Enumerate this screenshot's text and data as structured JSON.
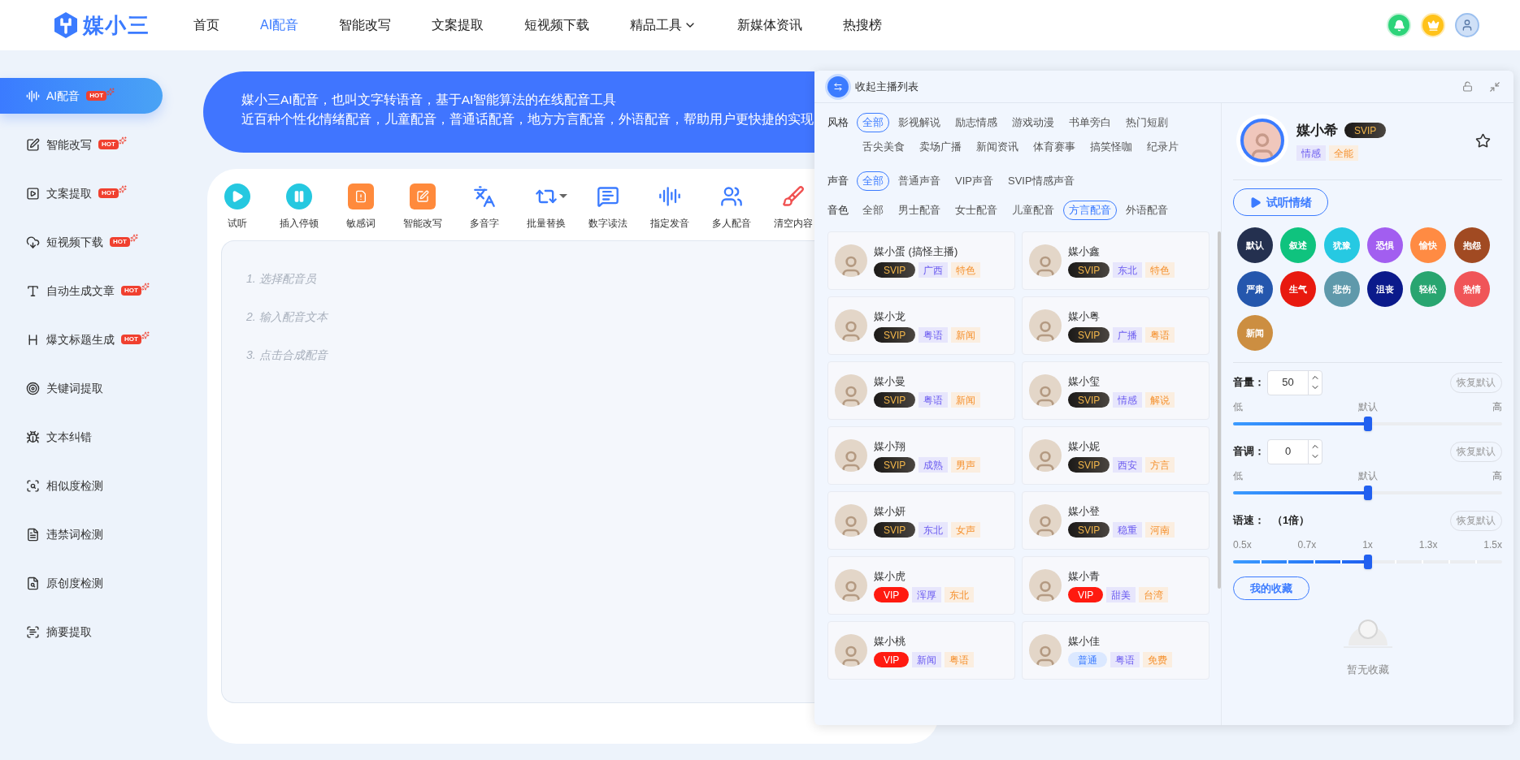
{
  "header": {
    "logo": "媒小三",
    "nav": [
      {
        "label": "首页",
        "selected": false,
        "has_menu": false
      },
      {
        "label": "AI配音",
        "selected": true,
        "has_menu": false
      },
      {
        "label": "智能改写",
        "selected": false,
        "has_menu": false
      },
      {
        "label": "文案提取",
        "selected": false,
        "has_menu": false
      },
      {
        "label": "短视频下载",
        "selected": false,
        "has_menu": false
      },
      {
        "label": "精品工具",
        "selected": false,
        "has_menu": true
      },
      {
        "label": "新媒体资讯",
        "selected": false,
        "has_menu": false
      },
      {
        "label": "热搜榜",
        "selected": false,
        "has_menu": false
      }
    ]
  },
  "sidebar": {
    "items": [
      {
        "label": "AI配音",
        "selected": true,
        "badge": "HOT"
      },
      {
        "label": "智能改写",
        "selected": false,
        "badge": "HOT"
      },
      {
        "label": "文案提取",
        "selected": false,
        "badge": "HOT"
      },
      {
        "label": "短视频下载",
        "selected": false,
        "badge": "HOT"
      },
      {
        "label": "自动生成文章",
        "selected": false,
        "badge": "HOT"
      },
      {
        "label": "爆文标题生成",
        "selected": false,
        "badge": "HOT"
      },
      {
        "label": "关键词提取",
        "selected": false
      },
      {
        "label": "文本纠错",
        "selected": false
      },
      {
        "label": "相似度检测",
        "selected": false
      },
      {
        "label": "违禁词检测",
        "selected": false
      },
      {
        "label": "原创度检测",
        "selected": false
      },
      {
        "label": "摘要提取",
        "selected": false
      }
    ]
  },
  "banner": {
    "lines": [
      "媒小三AI配音，也叫文字转语音，基于AI智能算法的在线配音工具",
      "近百种个性化情绪配音，儿童配音，普通话配音，地方方言配音，外语配音，帮助用户更快捷的实现"
    ]
  },
  "toolbar": [
    {
      "label": "试听",
      "has_menu": false
    },
    {
      "label": "插入停顿",
      "has_menu": false
    },
    {
      "label": "敏感词",
      "has_menu": false
    },
    {
      "label": "智能改写",
      "has_menu": false
    },
    {
      "label": "多音字",
      "has_menu": false
    },
    {
      "label": "批量替换",
      "has_menu": true
    },
    {
      "label": "数字读法",
      "has_menu": false
    },
    {
      "label": "指定发音",
      "has_menu": false
    },
    {
      "label": "多人配音",
      "has_menu": false
    },
    {
      "label": "清空内容",
      "has_menu": false
    }
  ],
  "editor": {
    "steps": [
      "1. 选择配音员",
      "2. 输入配音文本",
      "3. 点击合成配音"
    ]
  },
  "panel": {
    "collapse_label": "收起主播列表",
    "filters": [
      {
        "label": "风格",
        "options": [
          {
            "label": "全部",
            "selected": true
          },
          {
            "label": "影视解说",
            "selected": false
          },
          {
            "label": "励志情感",
            "selected": false
          },
          {
            "label": "游戏动漫",
            "selected": false
          },
          {
            "label": "书单旁白",
            "selected": false
          },
          {
            "label": "热门短剧",
            "selected": false
          },
          {
            "label": "舌尖美食",
            "selected": false
          },
          {
            "label": "卖场广播",
            "selected": false
          },
          {
            "label": "新闻资讯",
            "selected": false
          },
          {
            "label": "体育赛事",
            "selected": false
          },
          {
            "label": "搞笑怪咖",
            "selected": false
          },
          {
            "label": "纪录片",
            "selected": false
          }
        ]
      },
      {
        "label": "声音",
        "options": [
          {
            "label": "全部",
            "selected": true
          },
          {
            "label": "普通声音",
            "selected": false
          },
          {
            "label": "VIP声音",
            "selected": false
          },
          {
            "label": "SVIP情感声音",
            "selected": false
          }
        ]
      },
      {
        "label": "音色",
        "options": [
          {
            "label": "全部",
            "selected": false
          },
          {
            "label": "男士配音",
            "selected": false
          },
          {
            "label": "女士配音",
            "selected": false
          },
          {
            "label": "儿童配音",
            "selected": false
          },
          {
            "label": "方言配音",
            "selected": true
          },
          {
            "label": "外语配音",
            "selected": false
          }
        ]
      }
    ],
    "voices": [
      {
        "name": "媒小蛋 (搞怪主播)",
        "tier": {
          "text": "SVIP",
          "kind": "svip"
        },
        "tags": [
          "广西",
          "特色"
        ]
      },
      {
        "name": "媒小鑫",
        "tier": {
          "text": "SVIP",
          "kind": "svip"
        },
        "tags": [
          "东北",
          "特色"
        ]
      },
      {
        "name": "媒小龙",
        "tier": {
          "text": "SVIP",
          "kind": "svip"
        },
        "tags": [
          "粤语",
          "新闻"
        ]
      },
      {
        "name": "媒小粤",
        "tier": {
          "text": "SVIP",
          "kind": "svip"
        },
        "tags": [
          "广播",
          "粤语"
        ]
      },
      {
        "name": "媒小曼",
        "tier": {
          "text": "SVIP",
          "kind": "svip"
        },
        "tags": [
          "粤语",
          "新闻"
        ]
      },
      {
        "name": "媒小玺",
        "tier": {
          "text": "SVIP",
          "kind": "svip"
        },
        "tags": [
          "情感",
          "解说"
        ]
      },
      {
        "name": "媒小翔",
        "tier": {
          "text": "SVIP",
          "kind": "svip"
        },
        "tags": [
          "成熟",
          "男声"
        ]
      },
      {
        "name": "媒小妮",
        "tier": {
          "text": "SVIP",
          "kind": "svip"
        },
        "tags": [
          "西安",
          "方言"
        ]
      },
      {
        "name": "媒小妍",
        "tier": {
          "text": "SVIP",
          "kind": "svip"
        },
        "tags": [
          "东北",
          "女声"
        ]
      },
      {
        "name": "媒小登",
        "tier": {
          "text": "SVIP",
          "kind": "svip"
        },
        "tags": [
          "稳重",
          "河南"
        ]
      },
      {
        "name": "媒小虎",
        "tier": {
          "text": "VIP",
          "kind": "vip"
        },
        "tags": [
          "浑厚",
          "东北"
        ]
      },
      {
        "name": "媒小青",
        "tier": {
          "text": "VIP",
          "kind": "vip"
        },
        "tags": [
          "甜美",
          "台湾"
        ]
      },
      {
        "name": "媒小桃",
        "tier": {
          "text": "VIP",
          "kind": "vip"
        },
        "tags": [
          "新闻",
          "粤语"
        ]
      },
      {
        "name": "媒小佳",
        "tier": {
          "text": "普通",
          "kind": "free"
        },
        "tags": [
          "粤语",
          "免费"
        ]
      }
    ],
    "current": {
      "name": "媒小希",
      "tier": {
        "text": "SVIP",
        "kind": "svip"
      },
      "tags": [
        "情感",
        "全能"
      ],
      "favorite": false,
      "preview_button": "试听情绪",
      "emotions": [
        {
          "label": "默认",
          "color": "#24304f"
        },
        {
          "label": "叙述",
          "color": "#0fc37e"
        },
        {
          "label": "犹豫",
          "color": "#26c9e2"
        },
        {
          "label": "恐惧",
          "color": "#a25ef0"
        },
        {
          "label": "愉快",
          "color": "#ff8b43"
        },
        {
          "label": "抱怨",
          "color": "#a14a22"
        },
        {
          "label": "严肃",
          "color": "#2557ad"
        },
        {
          "label": "生气",
          "color": "#e8190f"
        },
        {
          "label": "悲伤",
          "color": "#5f99ab"
        },
        {
          "label": "沮丧",
          "color": "#0b1a8b"
        },
        {
          "label": "轻松",
          "color": "#28a570"
        },
        {
          "label": "热情",
          "color": "#f05558"
        },
        {
          "label": "新闻",
          "color": "#cc8e41"
        }
      ],
      "controls": [
        {
          "kind": "stepper",
          "label": "音量：",
          "value": "50",
          "reset": "恢复默认",
          "scale": [
            "低",
            "默认",
            "高"
          ],
          "level": 0.5
        },
        {
          "kind": "stepper",
          "label": "音调：",
          "value": "0",
          "reset": "恢复默认",
          "scale": [
            "低",
            "默认",
            "高"
          ],
          "level": 0.5
        },
        {
          "kind": "steps",
          "label": "语速：",
          "value": "（1倍）",
          "reset": "恢复默认",
          "scale": [
            "0.5x",
            "0.7x",
            "1x",
            "1.3x",
            "1.5x"
          ],
          "level": 0.5
        }
      ],
      "favorites_button": "我的收藏",
      "empty_text": "暂无收藏"
    }
  }
}
